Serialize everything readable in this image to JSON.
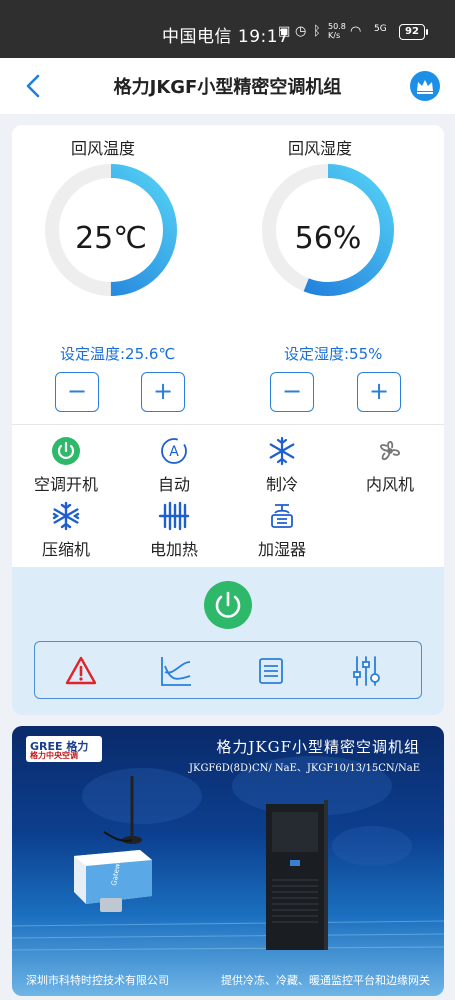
{
  "status_bar": {
    "text": "中国电信 19:17",
    "net_speed": "50.8 K/s",
    "signal": "5G",
    "battery": "92"
  },
  "header": {
    "title": "格力JKGF小型精密空调机组"
  },
  "gauges": [
    {
      "label": "回风温度",
      "value": "25℃",
      "fill": 0.5,
      "setpoint": "设定温度:25.6℃"
    },
    {
      "label": "回风湿度",
      "value": "56%",
      "fill": 0.56,
      "setpoint": "设定湿度:55%"
    }
  ],
  "stepper": {
    "minus": "−",
    "plus": "+"
  },
  "functions": [
    {
      "label": "空调开机",
      "icon": "power-on-icon",
      "color": "#2eb86a"
    },
    {
      "label": "自动",
      "icon": "auto-mode-icon",
      "color": "#1e5fcf"
    },
    {
      "label": "制冷",
      "icon": "snowflake-icon",
      "color": "#1e5fcf"
    },
    {
      "label": "内风机",
      "icon": "fan-icon",
      "color": "#777777"
    },
    {
      "label": "压缩机",
      "icon": "compressor-snowflake-icon",
      "color": "#1e5fcf"
    },
    {
      "label": "电加热",
      "icon": "heater-icon",
      "color": "#1e5fcf"
    },
    {
      "label": "加湿器",
      "icon": "humidifier-icon",
      "color": "#1e5fcf"
    }
  ],
  "toolbar": {
    "items": [
      "alarm-icon",
      "trend-chart-icon",
      "list-icon",
      "settings-sliders-icon"
    ]
  },
  "banner": {
    "brand": "GREE 格力",
    "brand_sub": "格力中央空调",
    "title": "格力JKGF小型精密空调机组",
    "models": "JKGF6D(8D)CN/ NaE、JKGF10/13/15CN/NaE",
    "company": "深圳市科特时控技术有限公司",
    "slogan": "提供冷冻、冷藏、暖通监控平台和边缘网关",
    "device_label": "Gateway"
  },
  "colors": {
    "accent": "#1e8fe6",
    "gauge_start": "#1a73d9",
    "gauge_end": "#55d3f5",
    "power": "#2eb86a",
    "alarm": "#e0242b"
  }
}
